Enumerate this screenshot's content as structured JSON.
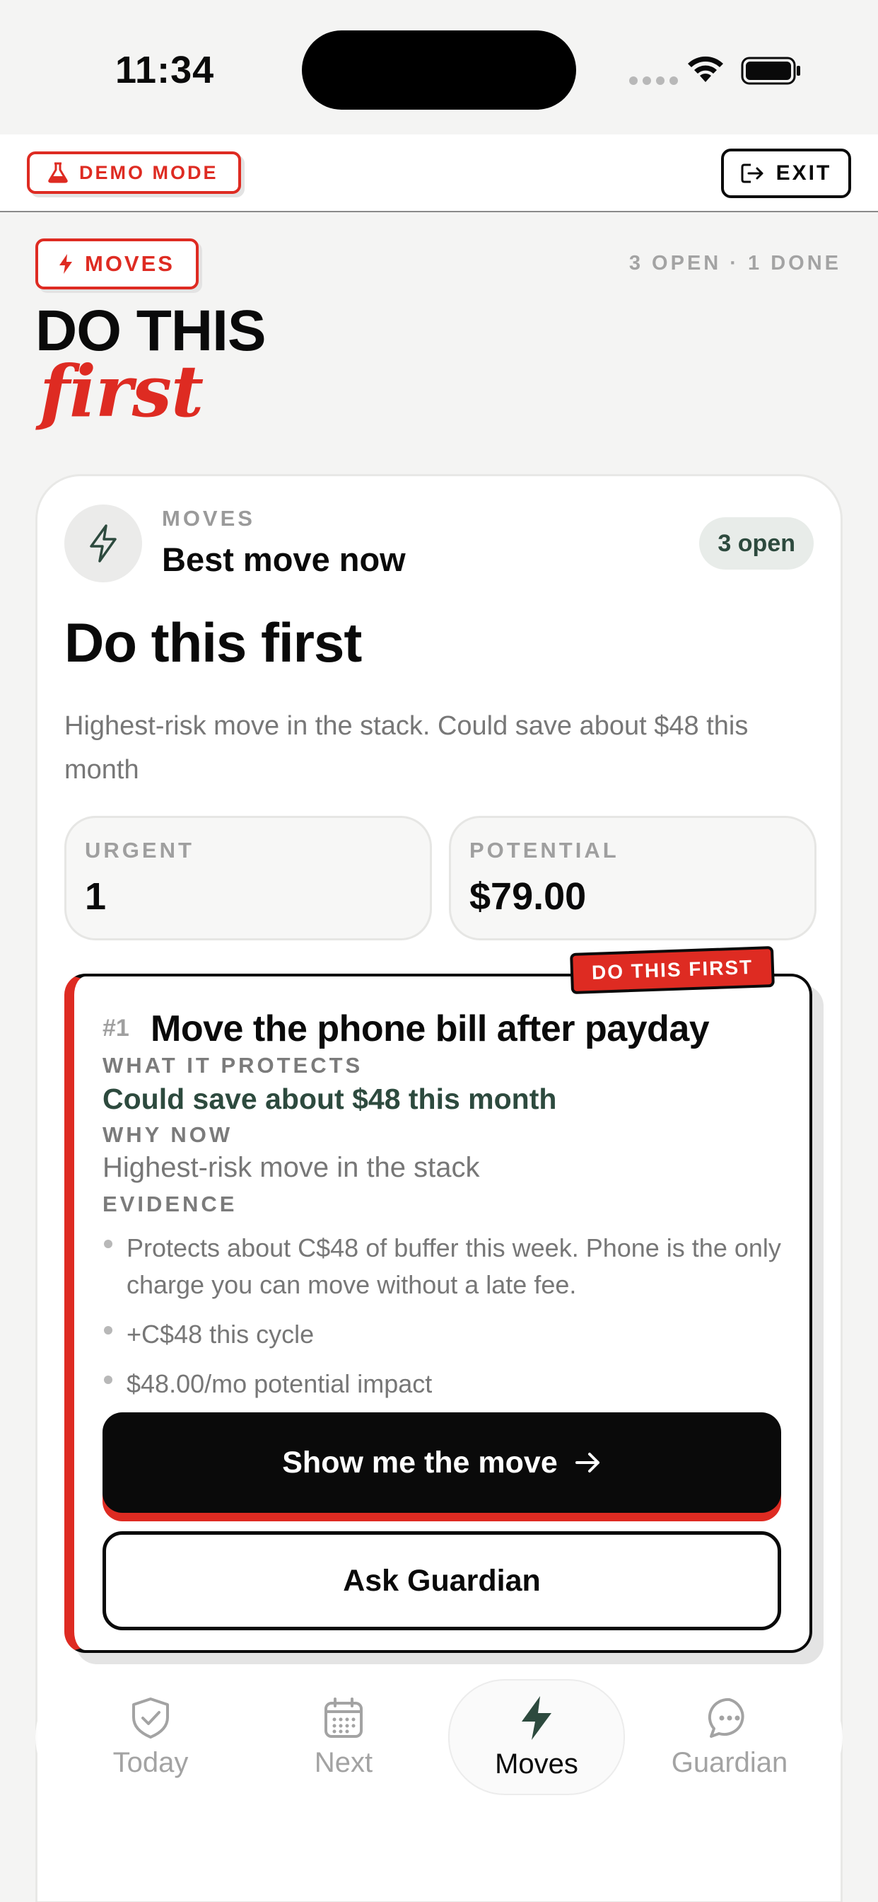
{
  "status_bar": {
    "time": "11:34"
  },
  "app_bar": {
    "demo_label": "DEMO MODE",
    "exit_label": "EXIT"
  },
  "header": {
    "tag": "MOVES",
    "counts": "3 OPEN · 1 DONE",
    "title_line1": "DO THIS",
    "title_line2": "first"
  },
  "card": {
    "eyebrow": "MOVES",
    "subtitle": "Best move now",
    "open_pill": "3 open",
    "title": "Do this first",
    "description": "Highest-risk move in the stack. Could save about $48 this month",
    "stats": [
      {
        "label": "URGENT",
        "value": "1"
      },
      {
        "label": "POTENTIAL",
        "value": "$79.00"
      }
    ]
  },
  "move": {
    "tag": "DO THIS FIRST",
    "rank": "#1",
    "title": "Move the phone bill after payday",
    "protects_label": "WHAT IT PROTECTS",
    "protects_value": "Could save about $48 this month",
    "why_label": "WHY NOW",
    "why_value": "Highest-risk move in the stack",
    "evidence_label": "EVIDENCE",
    "evidence": [
      "Protects about C$48 of buffer this week. Phone is the only charge you can move without a late fee.",
      "+C$48 this cycle",
      "$48.00/mo potential impact"
    ],
    "primary_action": "Show me the move",
    "secondary_action": "Ask Guardian"
  },
  "tabs": [
    {
      "label": "Today",
      "icon": "shield-check-icon",
      "active": false
    },
    {
      "label": "Next",
      "icon": "calendar-icon",
      "active": false
    },
    {
      "label": "Moves",
      "icon": "lightning-icon",
      "active": true
    },
    {
      "label": "Guardian",
      "icon": "chat-bubble-icon",
      "active": false
    }
  ],
  "colors": {
    "accent_red": "#de2b22",
    "forest_green": "#2d4a3e",
    "ink": "#0a0a0a",
    "background": "#f4f4f3"
  }
}
